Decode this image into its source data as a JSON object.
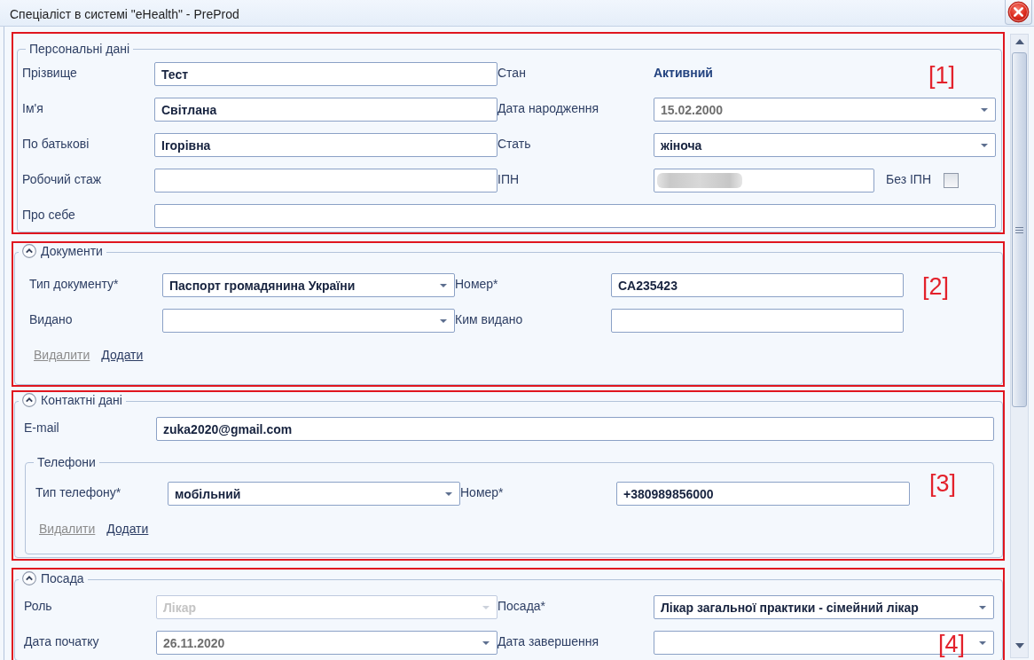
{
  "window": {
    "title": "Спеціаліст в системі \"eHealth\" - PreProd"
  },
  "sections": [
    {
      "kind": "personal",
      "title": "Персональні дані",
      "annotation": "[1]",
      "rows": [
        [
          {
            "label": "Прізвище",
            "field": {
              "kind": "text",
              "value": "Тест",
              "disabled": false
            }
          },
          {
            "label": "Стан",
            "field": {
              "kind": "status",
              "value": "Активний",
              "disabled": false
            }
          }
        ],
        [
          {
            "label": "Ім'я",
            "field": {
              "kind": "text",
              "value": "Світлана",
              "disabled": false
            }
          },
          {
            "label": "Дата народження",
            "field": {
              "kind": "date",
              "value": "15.02.2000",
              "disabled": false
            }
          }
        ],
        [
          {
            "label": "По батькові",
            "field": {
              "kind": "text",
              "value": "Ігорівна",
              "disabled": false
            }
          },
          {
            "label": "Стать",
            "field": {
              "kind": "select",
              "value": "жіноча",
              "disabled": false
            }
          }
        ],
        [
          {
            "label": "Робочий стаж",
            "field": {
              "kind": "text",
              "disabled": false
            }
          },
          {
            "label": "ІПН",
            "field": {
              "kind": "redacted",
              "disabled": false
            },
            "option": {
              "label": "Без ІПН",
              "checked": false
            }
          }
        ],
        [
          {
            "label": "Про себе",
            "field": {
              "kind": "text",
              "disabled": false
            }
          }
        ]
      ]
    },
    {
      "kind": "documents",
      "title": "Документи",
      "expanded": true,
      "annotation": "[2]",
      "rows": [
        [
          {
            "label": "Тип документу*",
            "field": {
              "kind": "select",
              "value": "Паспорт громадянина України",
              "disabled": false
            }
          },
          {
            "label": "Номер*",
            "field": {
              "kind": "text",
              "value": "CA235423",
              "disabled": false
            }
          }
        ],
        [
          {
            "label": "Видано",
            "field": {
              "kind": "date",
              "disabled": false
            }
          },
          {
            "label": "Ким видано",
            "field": {
              "kind": "text",
              "disabled": false
            }
          }
        ]
      ],
      "actions": [
        {
          "label": "Видалити",
          "disabled": true
        },
        {
          "label": "Додати",
          "disabled": false
        }
      ]
    },
    {
      "kind": "contacts",
      "title": "Контактні дані",
      "expanded": true,
      "annotation": "[3]",
      "rows": [
        [
          {
            "label": "E-mail",
            "field": {
              "kind": "text",
              "value": "zuka2020@gmail.com",
              "disabled": false
            }
          }
        ]
      ],
      "subgroup": {
        "title": "Телефони",
        "rows": [
          [
            {
              "label": "Тип телефону*",
              "field": {
                "kind": "select",
                "value": "мобільний",
                "disabled": false
              }
            },
            {
              "label": "Номер*",
              "field": {
                "kind": "text",
                "value": "+380989856000",
                "disabled": false
              }
            }
          ]
        ],
        "actions": [
          {
            "label": "Видалити",
            "disabled": true
          },
          {
            "label": "Додати",
            "disabled": false
          }
        ]
      }
    },
    {
      "kind": "position",
      "title": "Посада",
      "expanded": true,
      "annotation": "[4]",
      "rows": [
        [
          {
            "label": "Роль",
            "field": {
              "kind": "select",
              "value": "Лікар",
              "disabled": true
            }
          },
          {
            "label": "Посада*",
            "field": {
              "kind": "select",
              "value": "Лікар загальної практики - сімейний лікар",
              "disabled": false
            }
          }
        ],
        [
          {
            "label": "Дата початку",
            "field": {
              "kind": "date",
              "value": "26.11.2020",
              "disabled": false
            }
          },
          {
            "label": "Дата завершення",
            "field": {
              "kind": "date",
              "disabled": false
            }
          }
        ]
      ]
    }
  ]
}
